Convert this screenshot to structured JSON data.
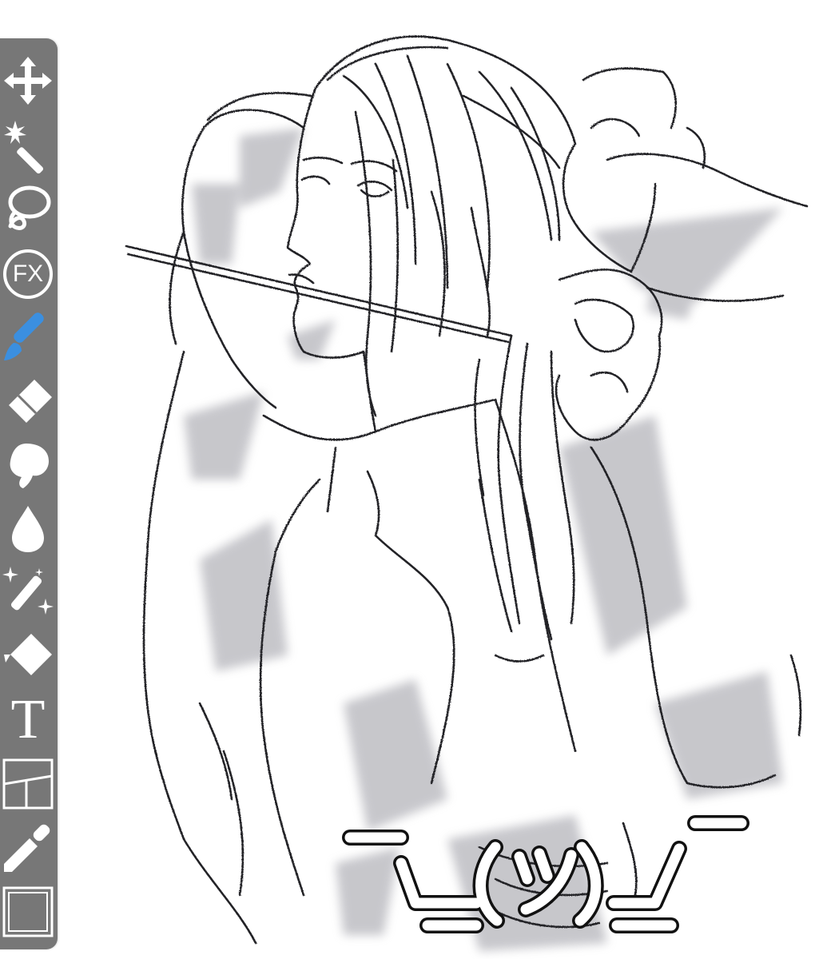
{
  "app": {
    "accent_color": "#3b8fe0",
    "toolbar_color": "#777777",
    "toolbar_icon_color": "#ffffff"
  },
  "toolbar": {
    "tools": [
      {
        "name": "transform",
        "icon": "move-arrows-icon",
        "active": false
      },
      {
        "name": "magic-wand",
        "icon": "magic-wand-icon",
        "active": false
      },
      {
        "name": "lasso",
        "icon": "lasso-icon",
        "active": false
      },
      {
        "name": "filter",
        "icon": "fx-icon",
        "label": "FX",
        "active": false
      },
      {
        "name": "brush",
        "icon": "brush-icon",
        "active": true
      },
      {
        "name": "eraser",
        "icon": "eraser-icon",
        "active": false
      },
      {
        "name": "smudge",
        "icon": "smudge-finger-icon",
        "active": false
      },
      {
        "name": "blur",
        "icon": "droplet-icon",
        "active": false
      },
      {
        "name": "special-brush",
        "icon": "sparkle-pen-icon",
        "active": false
      },
      {
        "name": "fill",
        "icon": "fill-bucket-icon",
        "active": false
      },
      {
        "name": "text",
        "icon": "text-icon",
        "label": "T",
        "active": false
      },
      {
        "name": "frame-divider",
        "icon": "panels-icon",
        "active": false
      },
      {
        "name": "eyedropper",
        "icon": "eyedropper-icon",
        "active": false
      },
      {
        "name": "canvas",
        "icon": "canvas-frame-icon",
        "active": false
      }
    ]
  },
  "artwork": {
    "caption": "¯\\_(ツ)_/¯"
  }
}
